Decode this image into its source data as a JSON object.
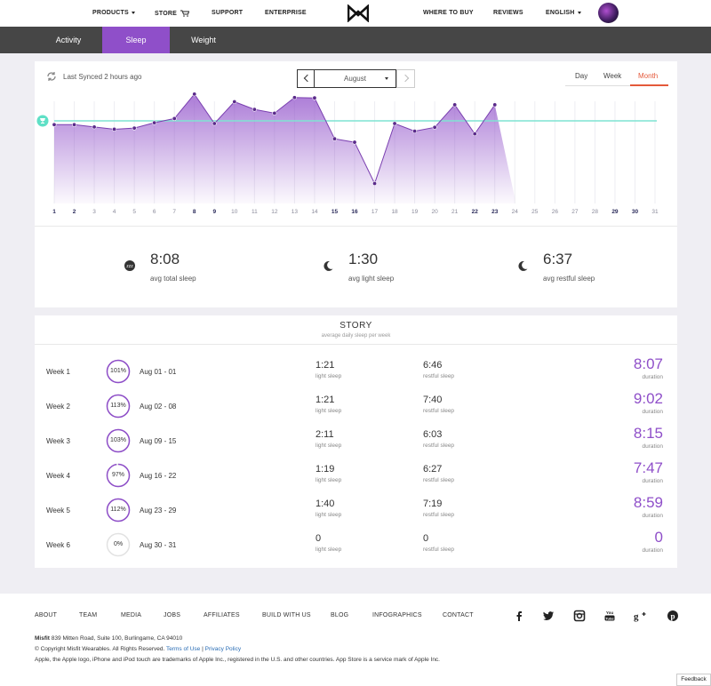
{
  "colors": {
    "accent": "#8f4fc9",
    "goal_line": "#7fe3d2",
    "month_active": "#e4593a"
  },
  "topnav": {
    "products": "PRODUCTS",
    "store": "STORE",
    "support": "SUPPORT",
    "enterprise": "ENTERPRISE",
    "where_to_buy": "WHERE TO BUY",
    "reviews": "REVIEWS",
    "language": "ENGLISH"
  },
  "subnav": {
    "tabs": [
      "Activity",
      "Sleep",
      "Weight"
    ],
    "active": "Sleep"
  },
  "sync": {
    "text": "Last Synced 2 hours ago"
  },
  "month_selector": {
    "value": "August"
  },
  "range_tabs": {
    "day": "Day",
    "week": "Week",
    "month": "Month",
    "active": "Month"
  },
  "chart_data": {
    "type": "area",
    "x": [
      1,
      2,
      3,
      4,
      5,
      6,
      7,
      8,
      9,
      10,
      11,
      12,
      13,
      14,
      15,
      16,
      17,
      18,
      19,
      20,
      21,
      22,
      23,
      24,
      25,
      26,
      27,
      28,
      29,
      30,
      31
    ],
    "x_bold": [
      1,
      2,
      8,
      9,
      15,
      16,
      22,
      23,
      29,
      30
    ],
    "series": [
      {
        "values": [
          0.1,
          0.1,
          0.16,
          0.22,
          0.19,
          0.05,
          -0.06,
          -0.7,
          0.07,
          -0.5,
          -0.3,
          -0.2,
          -0.61,
          -0.6,
          0.47,
          0.56,
          1.64,
          0.07,
          0.27,
          0.17,
          -0.42,
          0.34,
          -0.42,
          null,
          null,
          null,
          null,
          null,
          null,
          null,
          null
        ]
      }
    ],
    "goal": 0,
    "fill_to_x": 24,
    "goal_marker": "trophy-icon"
  },
  "stats": [
    {
      "value": "8:08",
      "label": "avg total sleep",
      "icon": "sleep-icon"
    },
    {
      "value": "1:30",
      "label": "avg light sleep",
      "icon": "moon-icon"
    },
    {
      "value": "6:37",
      "label": "avg restful sleep",
      "icon": "moon-icon"
    }
  ],
  "story": {
    "title": "STORY",
    "subtitle": "average daily sleep per week",
    "light_label": "light sleep",
    "restful_label": "restful sleep",
    "duration_label": "duration",
    "weeks": [
      {
        "week": "Week 1",
        "pct": "101%",
        "pct_value": 1.0,
        "dates": "Aug 01 - 01",
        "light": "1:21",
        "restful": "6:46",
        "duration": "8:07"
      },
      {
        "week": "Week 2",
        "pct": "113%",
        "pct_value": 1.0,
        "dates": "Aug 02 - 08",
        "light": "1:21",
        "restful": "7:40",
        "duration": "9:02"
      },
      {
        "week": "Week 3",
        "pct": "103%",
        "pct_value": 1.0,
        "dates": "Aug 09 - 15",
        "light": "2:11",
        "restful": "6:03",
        "duration": "8:15"
      },
      {
        "week": "Week 4",
        "pct": "97%",
        "pct_value": 0.97,
        "dates": "Aug 16 - 22",
        "light": "1:19",
        "restful": "6:27",
        "duration": "7:47"
      },
      {
        "week": "Week 5",
        "pct": "112%",
        "pct_value": 1.0,
        "dates": "Aug 23 - 29",
        "light": "1:40",
        "restful": "7:19",
        "duration": "8:59"
      },
      {
        "week": "Week 6",
        "pct": "0%",
        "pct_value": 0,
        "dates": "Aug 30 - 31",
        "light": "0",
        "restful": "0",
        "duration": "0"
      }
    ]
  },
  "footer": {
    "links": [
      "ABOUT",
      "TEAM",
      "MEDIA",
      "JOBS",
      "AFFILIATES",
      "BUILD WITH US",
      "BLOG",
      "INFOGRAPHICS",
      "CONTACT"
    ],
    "social": [
      "facebook-icon",
      "twitter-icon",
      "instagram-icon",
      "youtube-icon",
      "google-plus-icon",
      "pinterest-icon"
    ],
    "company": "Misfit",
    "address": "839 Mitten Road, Suite 100, Burlingame, CA 94010",
    "copyright": "© Copyright Misfit Wearables. All Rights Reserved.",
    "terms": "Terms of Use",
    "separator": "|",
    "privacy": "Privacy Policy",
    "trademark": "Apple, the Apple logo, iPhone and iPod touch are trademarks of Apple Inc., registered in the U.S. and other countries. App Store is a service mark of Apple Inc."
  },
  "feedback": "Feedback"
}
